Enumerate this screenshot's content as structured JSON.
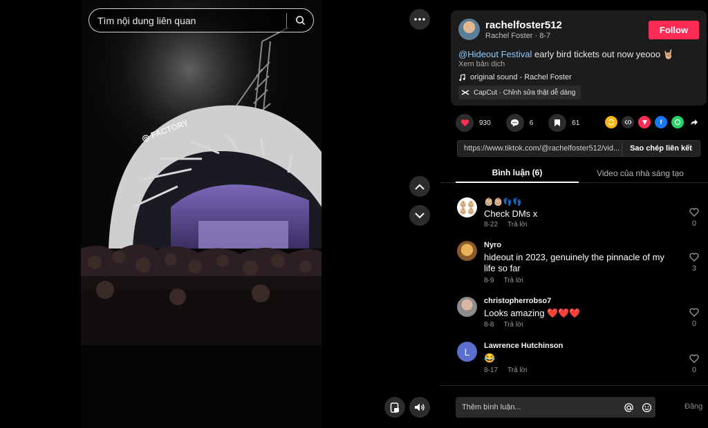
{
  "search": {
    "placeholder": "Tìm nội dung liên quan"
  },
  "author": {
    "username": "rachelfoster512",
    "subtitle": "Rachel Foster · 8-7",
    "follow_label": "Follow"
  },
  "post": {
    "mention": "@Hideout Festival",
    "caption": " early bird tickets out now yeooo 🤘🏼",
    "translate_label": "Xem bản dịch",
    "sound": "original sound - Rachel Foster",
    "capcut": "CapCut · Chỉnh sửa thật dễ dàng"
  },
  "stats": {
    "likes": "930",
    "comments": "6",
    "saves": "61"
  },
  "share_icons": [
    "repost-icon",
    "embed-icon",
    "send-icon",
    "facebook-icon",
    "whatsapp-icon",
    "share-arrow-icon"
  ],
  "link": {
    "url": "https://www.tiktok.com/@rachelfoster512/vid...",
    "copy_label": "Sao chép liên kết"
  },
  "tabs": {
    "comments": "Bình luận (6)",
    "creator_videos": "Video của nhà sáng tạo"
  },
  "comments": [
    {
      "name": "👶🏼👶🏼👣👣",
      "text": "Check DMs x",
      "date": "8-22",
      "reply": "Trả lời",
      "likes": "0"
    },
    {
      "name": "Nyro",
      "text": "hideout in 2023, genuinely the pinnacle of my life so far",
      "date": "8-9",
      "reply": "Trả lời",
      "likes": "3"
    },
    {
      "name": "christopherrobso7",
      "text": "Looks amazing ❤️❤️❤️",
      "date": "8-8",
      "reply": "Trả lời",
      "likes": "0"
    },
    {
      "name": "Lawrence Hutchinson",
      "text": "😂",
      "date": "8-17",
      "reply": "Trả lời",
      "likes": "0",
      "avatar_letter": "L"
    }
  ],
  "composer": {
    "placeholder": "Thêm bình luận...",
    "post_label": "Đăng"
  },
  "colors": {
    "accent": "#fe2c55",
    "mention": "#8ecbff",
    "background": "#000000",
    "card": "#1c1c1c"
  }
}
